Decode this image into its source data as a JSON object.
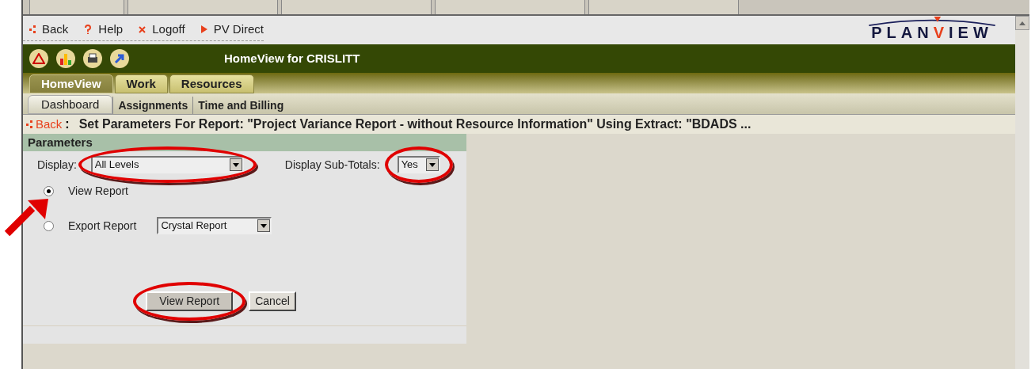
{
  "nav_links": [
    {
      "kind": "back",
      "label": "Back"
    },
    {
      "kind": "help",
      "label": "Help"
    },
    {
      "kind": "logoff",
      "label": "Logoff"
    },
    {
      "kind": "direct",
      "label": "PV Direct"
    }
  ],
  "logo": {
    "before": "PLAN",
    "accent": "V",
    "after": "IEW"
  },
  "header_title": "HomeView for CRISLITT",
  "tabs": [
    {
      "label": "HomeView",
      "selected": true
    },
    {
      "label": "Work",
      "selected": false
    },
    {
      "label": "Resources",
      "selected": false
    }
  ],
  "subtabs": [
    {
      "label": "Dashboard",
      "selected": true
    },
    {
      "label": "Assignments",
      "selected": false
    },
    {
      "label": "Time and Billing",
      "selected": false
    }
  ],
  "page_title": {
    "back": "Back",
    "separator": ":",
    "text": "Set Parameters For Report: \"Project Variance Report - without Resource Information\" Using Extract: \"BDADS ..."
  },
  "parameters": {
    "header": "Parameters",
    "display_label": "Display:",
    "display_value": "All Levels",
    "subtotals_label": "Display Sub-Totals:",
    "subtotals_value": "Yes",
    "options": [
      {
        "label": "View Report",
        "selected": true
      },
      {
        "label": "Export Report",
        "selected": false,
        "format": "Crystal Report"
      }
    ],
    "buttons": [
      "View Report",
      "Cancel"
    ]
  }
}
